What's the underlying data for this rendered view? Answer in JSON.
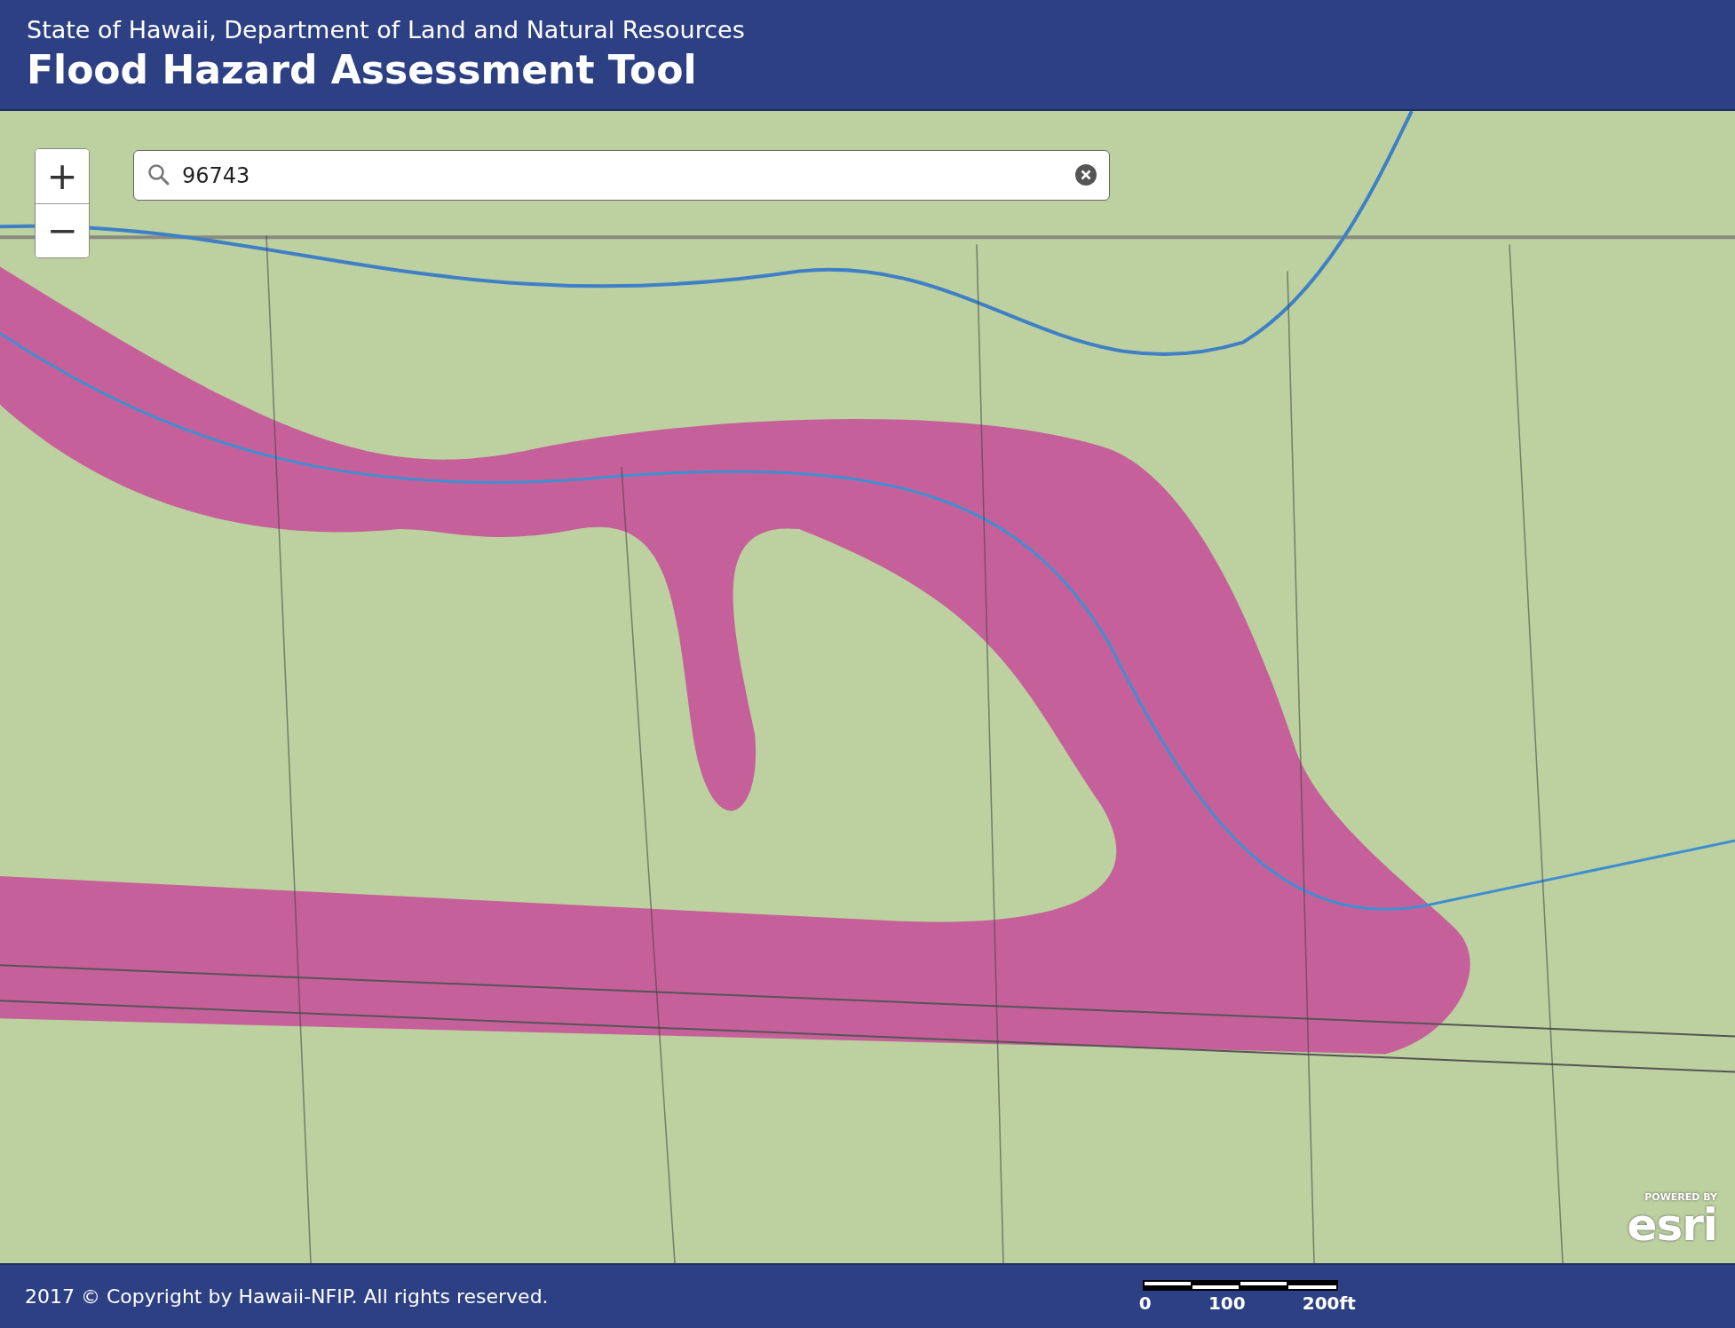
{
  "header": {
    "subtitle": "State of Hawaii, Department of Land and Natural Resources",
    "title": "Flood Hazard Assessment Tool"
  },
  "map": {
    "zoom_in": "+",
    "zoom_out": "−",
    "search": {
      "value": "96743"
    },
    "attribution": {
      "small": "POWERED BY",
      "logo": "esri"
    }
  },
  "footer": {
    "copyright": "2017 © Copyright by Hawaii-NFIP. All rights reserved.",
    "scale_labels": [
      "0",
      "100",
      "200ft"
    ]
  }
}
